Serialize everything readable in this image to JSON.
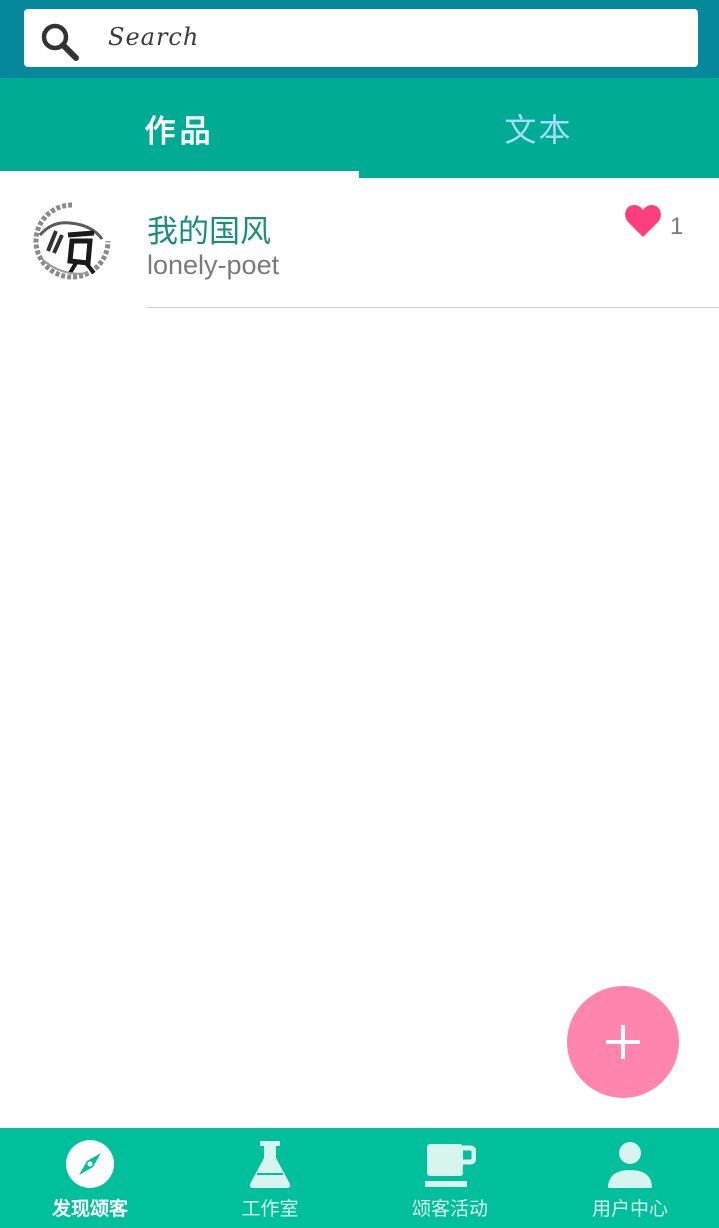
{
  "search": {
    "placeholder": "Search"
  },
  "tabs": [
    {
      "label": "作品",
      "active": true
    },
    {
      "label": "文本",
      "active": false
    }
  ],
  "list": [
    {
      "title": "我的国风",
      "author": "lonely-poet",
      "likes": "1"
    }
  ],
  "fab": {
    "icon": "plus-icon"
  },
  "bottom_nav": [
    {
      "label": "发现颂客",
      "icon": "compass-icon",
      "active": true
    },
    {
      "label": "工作室",
      "icon": "flask-icon",
      "active": false
    },
    {
      "label": "颂客活动",
      "icon": "coffee-cup-icon",
      "active": false
    },
    {
      "label": "用户中心",
      "icon": "user-icon",
      "active": false
    }
  ],
  "colors": {
    "header": "#05889a",
    "tabs": "#00ab93",
    "bottom_nav": "#00bf9b",
    "title": "#1a8d7e",
    "heart": "#ff3d7f",
    "fab": "#ff84ae"
  }
}
